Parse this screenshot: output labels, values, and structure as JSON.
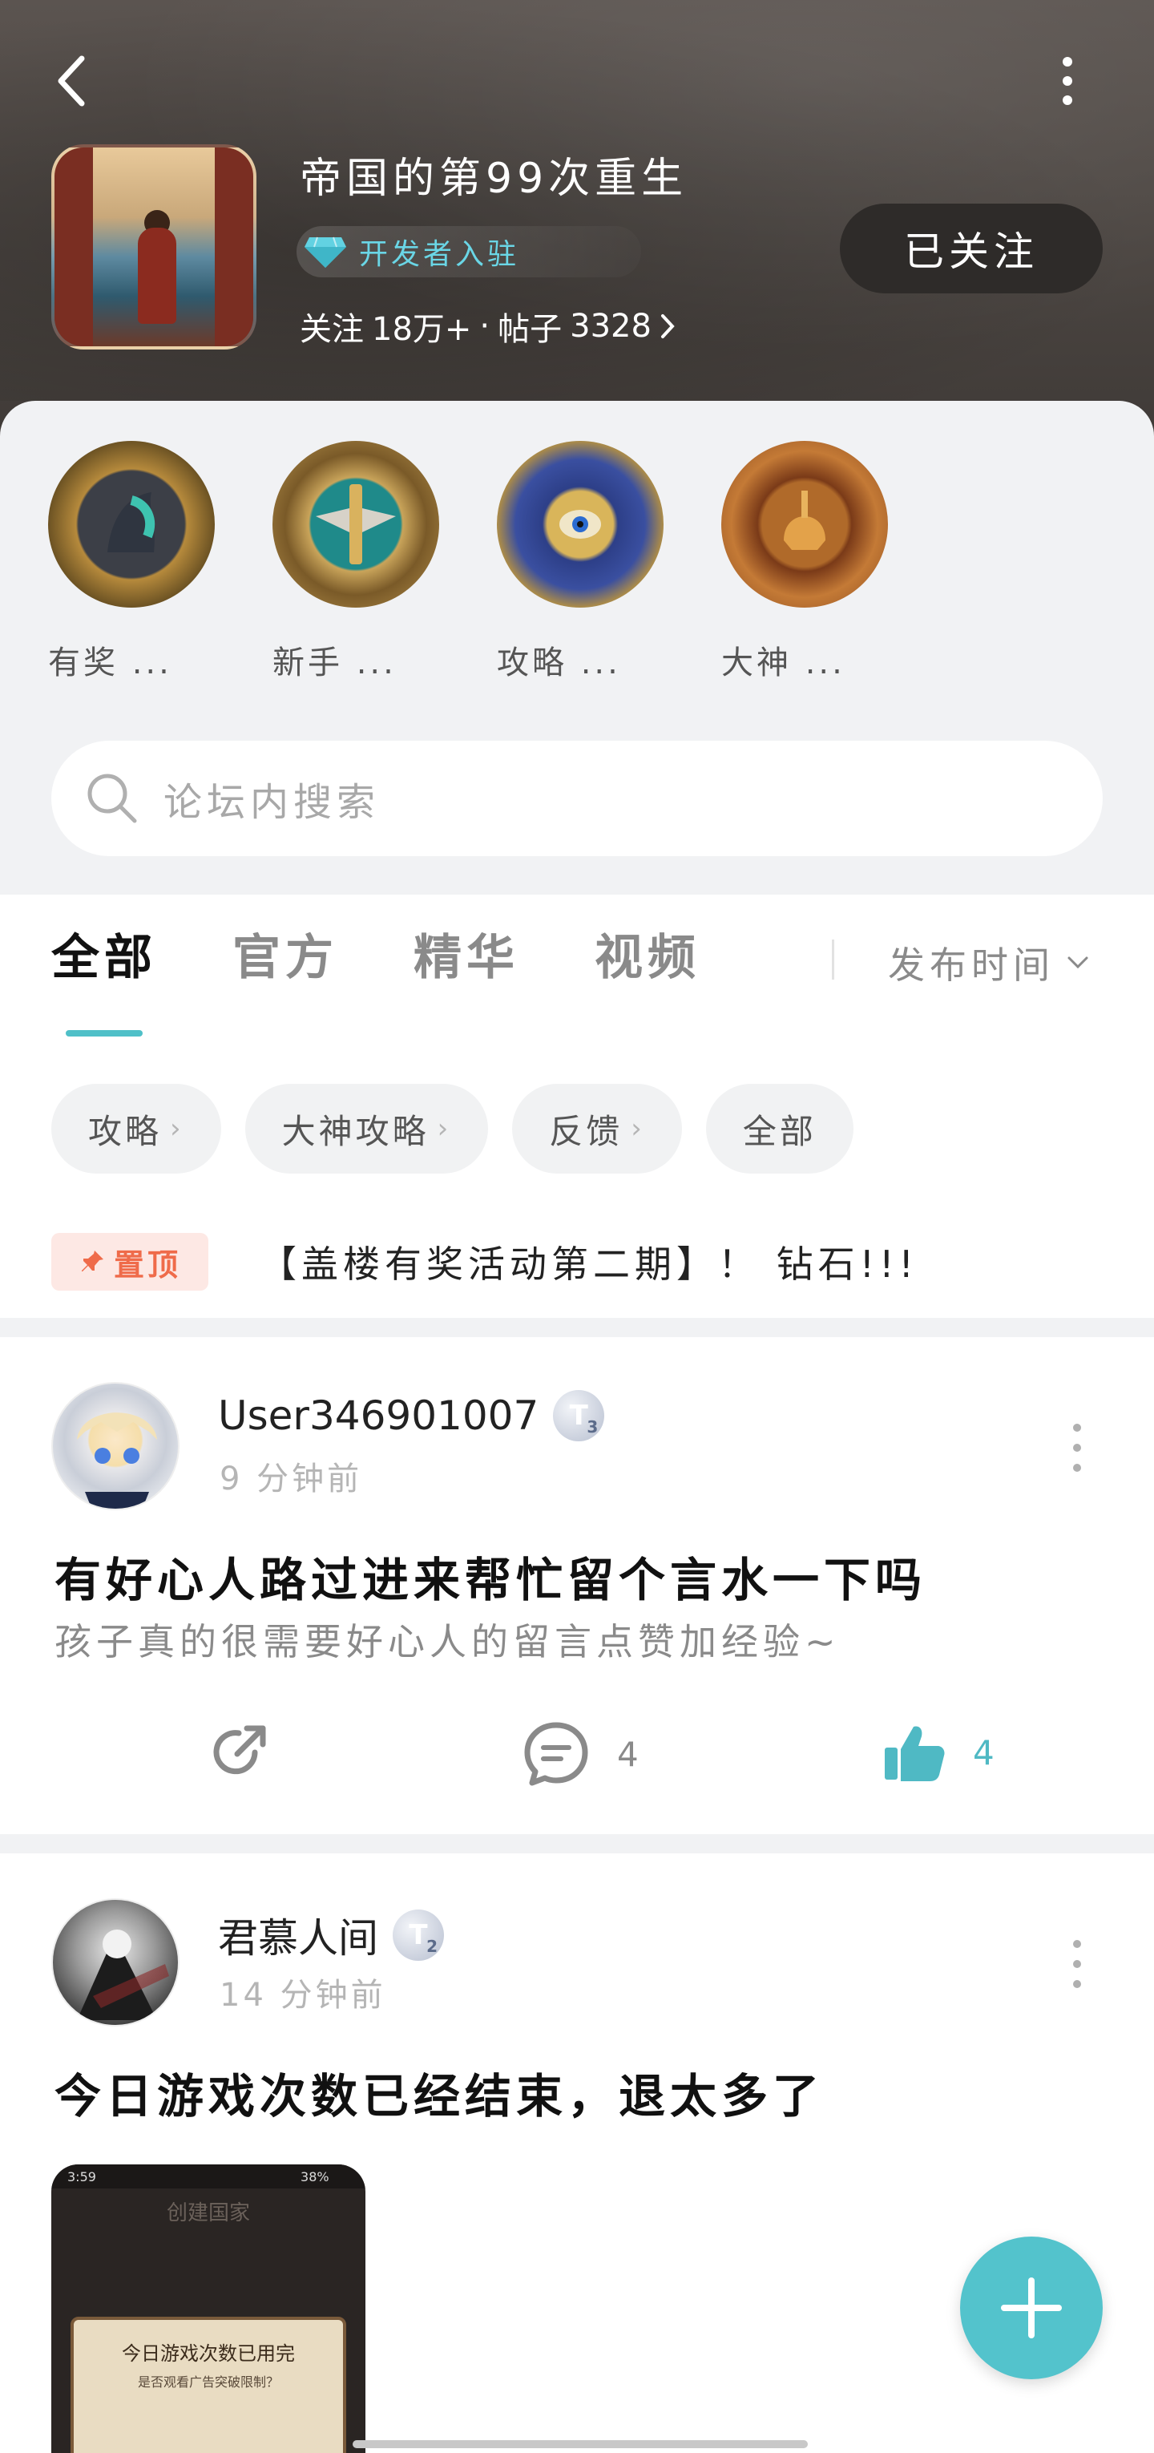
{
  "header": {
    "game_title": "帝国的第99次重生",
    "developer_badge": "开发者入驻",
    "follow_label": "关注",
    "followers": "18万+",
    "dot": "·",
    "posts_label": "帖子",
    "posts_count": "3328",
    "follow_button": "已关注"
  },
  "badges": [
    {
      "label": "有奖 ..."
    },
    {
      "label": "新手 ..."
    },
    {
      "label": "攻略 ..."
    },
    {
      "label": "大神 ..."
    }
  ],
  "search": {
    "placeholder": "论坛内搜索"
  },
  "tabs": [
    {
      "label": "全部"
    },
    {
      "label": "官方"
    },
    {
      "label": "精华"
    },
    {
      "label": "视频"
    }
  ],
  "sort": {
    "label": "发布时间"
  },
  "chips": [
    {
      "label": "攻略"
    },
    {
      "label": "大神攻略"
    },
    {
      "label": "反馈"
    },
    {
      "label": "全部"
    }
  ],
  "pinned": {
    "tag": "置顶",
    "title": "【盖楼有奖活动第二期】！ 钻石!!!"
  },
  "posts": [
    {
      "username": "User346901007",
      "level": "T",
      "level_num": "3",
      "time": "9 分钟前",
      "title": "有好心人路过进来帮忙留个言水一下吗",
      "body": "孩子真的很需要好心人的留言点赞加经验~",
      "comments": "4",
      "likes": "4"
    },
    {
      "username": "君慕人间",
      "level": "T",
      "level_num": "2",
      "time": "14 分钟前",
      "title": "今日游戏次数已经结束，退太多了",
      "thumb_status": "3:59",
      "thumb_battery": "38%",
      "thumb_header": "创建国家",
      "thumb_text1": "今日游戏次数已用完",
      "thumb_text2": "是否观看广告突破限制？"
    }
  ],
  "colors": {
    "accent": "#53c3cc",
    "pin": "#ef6b4a",
    "header_bg": "#4e4844"
  }
}
